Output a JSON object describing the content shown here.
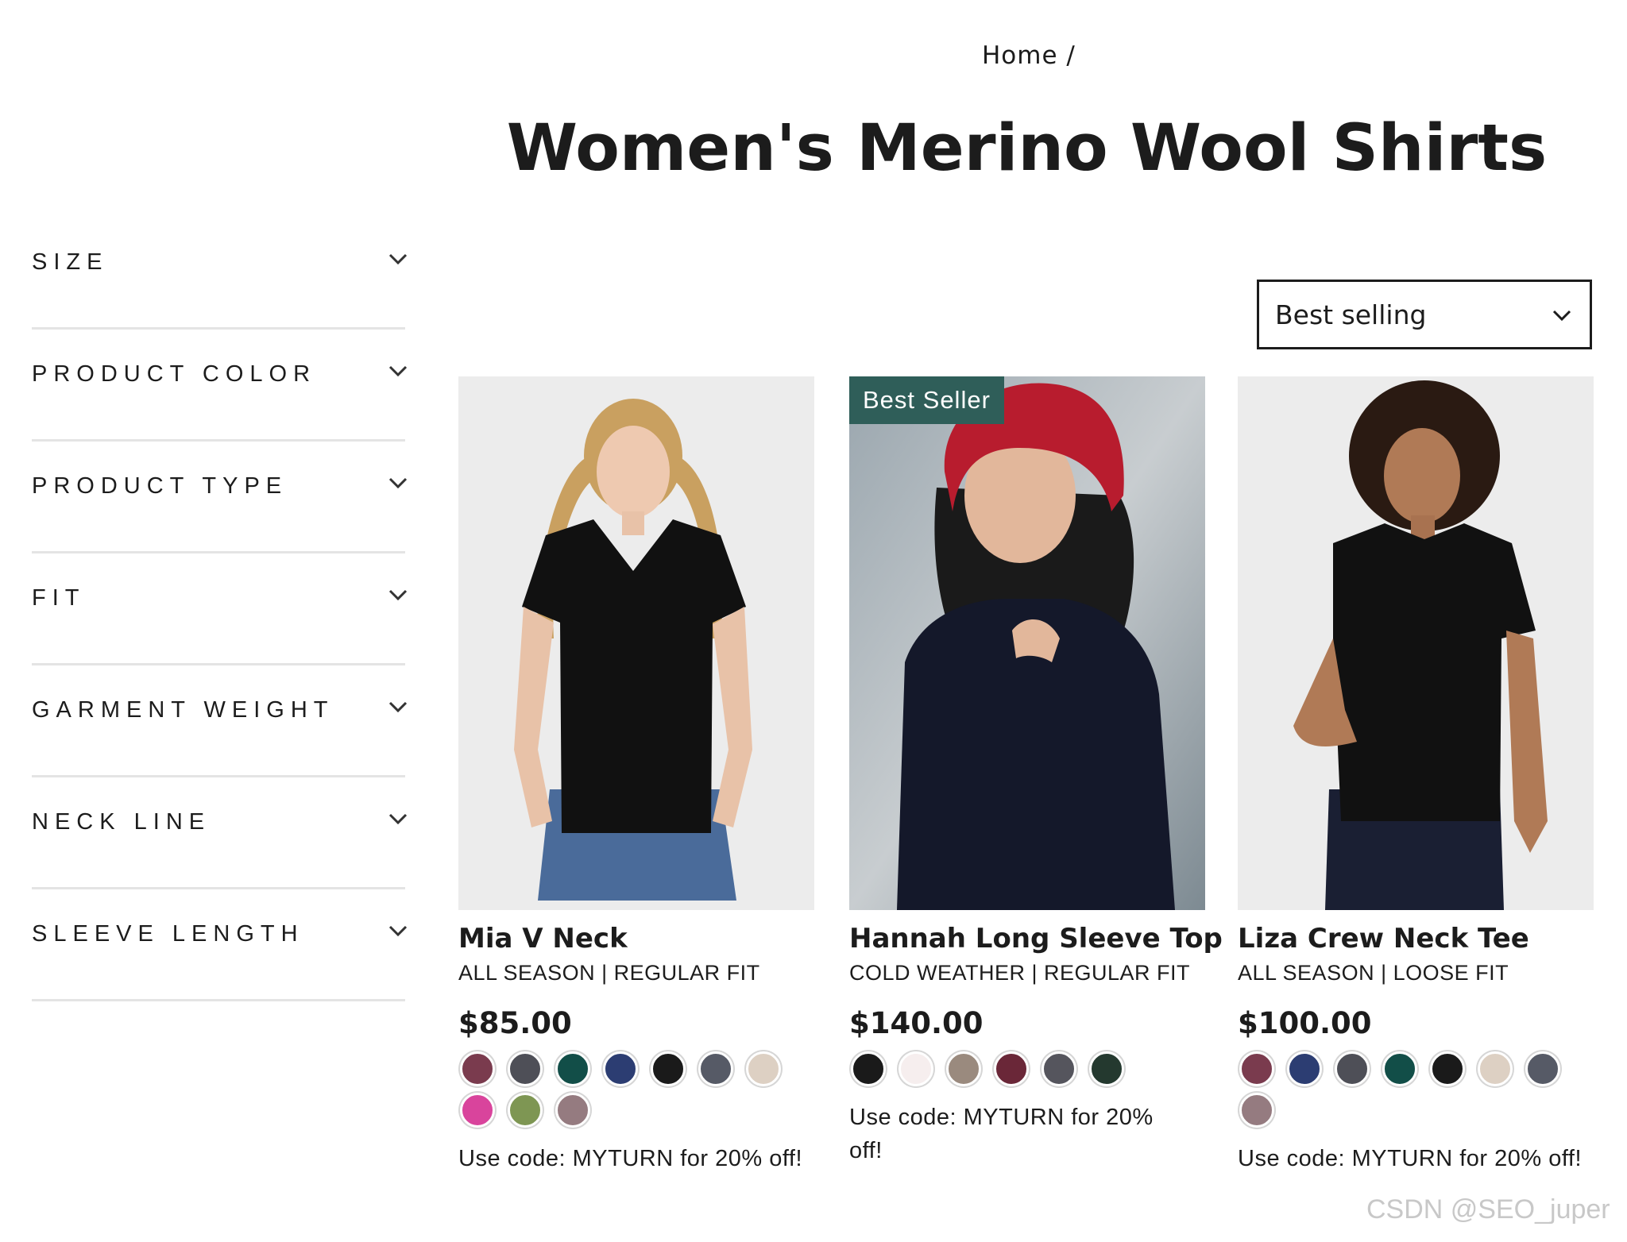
{
  "breadcrumb": {
    "home": "Home /"
  },
  "page_title": "Women's Merino Wool Shirts",
  "filters": [
    {
      "label": "SIZE",
      "icon": "chevron-down-icon"
    },
    {
      "label": "PRODUCT COLOR",
      "icon": "chevron-down-icon"
    },
    {
      "label": "PRODUCT TYPE",
      "icon": "chevron-down-icon"
    },
    {
      "label": "FIT",
      "icon": "chevron-down-icon"
    },
    {
      "label": "GARMENT WEIGHT",
      "icon": "chevron-down-icon"
    },
    {
      "label": "NECK LINE",
      "icon": "chevron-down-icon"
    },
    {
      "label": "SLEEVE LENGTH",
      "icon": "chevron-down-icon"
    }
  ],
  "sort": {
    "selected": "Best selling",
    "icon": "chevron-down-icon"
  },
  "products": [
    {
      "name": "Mia V Neck",
      "subtitle": "ALL SEASON | REGULAR FIT",
      "price": "$85.00",
      "badge": "",
      "swatches": [
        "#7a3b4e",
        "#4e4f57",
        "#124e48",
        "#2c3d72",
        "#1a1a1a",
        "#565a66",
        "#ddd0c3",
        "#d9449c",
        "#7e9653",
        "#957b80"
      ],
      "promo": "Use code: MYTURN for 20% off!"
    },
    {
      "name": "Hannah Long Sleeve Top",
      "subtitle": "COLD WEATHER | REGULAR FIT",
      "price": "$140.00",
      "badge": "Best Seller",
      "swatches": [
        "#1a1a1a",
        "#f6eeee",
        "#9a8a7e",
        "#6a2738",
        "#55555d",
        "#24392f"
      ],
      "promo": "Use code: MYTURN for 20% off!"
    },
    {
      "name": "Liza Crew Neck Tee",
      "subtitle": "ALL SEASON | LOOSE FIT",
      "price": "$100.00",
      "badge": "",
      "swatches": [
        "#7a3b4e",
        "#2c3d72",
        "#4e4f57",
        "#124e48",
        "#1a1a1a",
        "#ddd0c3",
        "#565a66",
        "#957b80"
      ],
      "promo": "Use code: MYTURN for 20% off!"
    }
  ],
  "watermark": "CSDN @SEO_juper",
  "colors": {
    "badge": "#2f5e59",
    "text": "#1c1c1c",
    "divider": "#e4e4e4"
  }
}
